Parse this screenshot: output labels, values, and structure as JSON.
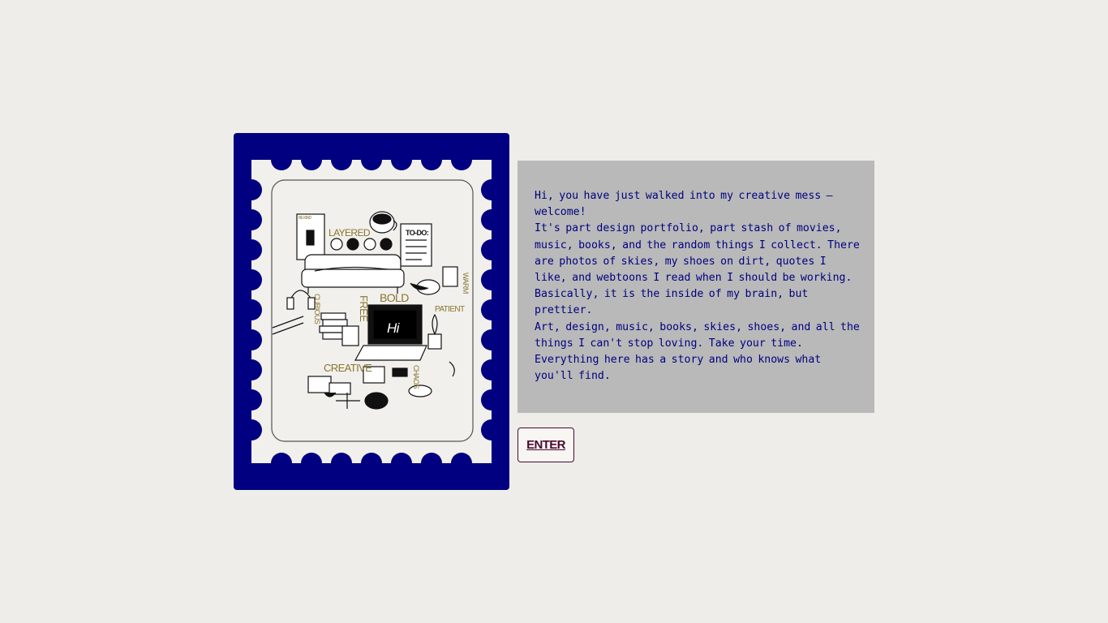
{
  "stamp": {
    "frame_color": "#000080",
    "paper_color": "#f1f0ec",
    "illustration": {
      "laptop_label": "Hi",
      "todo_label": "TO-DO:",
      "words": [
        "LAYERED",
        "FREE",
        "BOLD",
        "PATIENT",
        "WARM",
        "CURIOUS",
        "CREATIVE",
        "CHAOS"
      ],
      "word_color": "#8a7430"
    }
  },
  "intro": {
    "text": "Hi, you have just walked into my creative mess — welcome!\nIt's part design portfolio, part stash of movies, music, books, and the random things I collect. There are photos of skies, my shoes on dirt, quotes I like, and webtoons I read when I should be working. Basically, it is the inside of my brain, but prettier.\nArt, design, music, books, skies, shoes, and all the things I can't stop loving. Take your time. Everything here has a story and who knows what you'll find.",
    "text_color": "#000080",
    "background": "#b9b9b9"
  },
  "enter_button": {
    "label": "ENTER",
    "color": "#4a0833"
  }
}
